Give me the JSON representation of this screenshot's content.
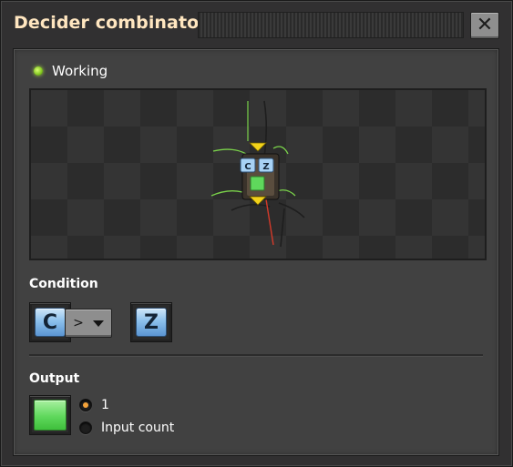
{
  "window": {
    "title": "Decider combinator",
    "close_label": "✕"
  },
  "status": {
    "text": "Working",
    "color": "#8fd12c"
  },
  "preview": {
    "badges": [
      "C",
      "Z"
    ],
    "icon_names": [
      "decider-combinator-entity",
      "signal-arrow-in",
      "signal-arrow-out"
    ]
  },
  "condition": {
    "label": "Condition",
    "first_signal": "C",
    "comparator": ">",
    "second_signal": "Z"
  },
  "output": {
    "label": "Output",
    "signal_color": "#5fd85c",
    "options": [
      {
        "label": "1",
        "selected": true
      },
      {
        "label": "Input count",
        "selected": false
      }
    ]
  }
}
